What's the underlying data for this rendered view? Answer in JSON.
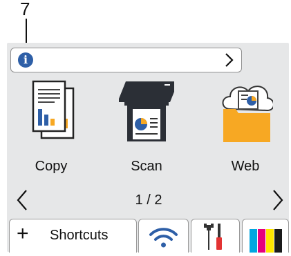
{
  "callout": {
    "number": "7"
  },
  "apps": [
    {
      "label": "Copy",
      "icon": "copy-icon"
    },
    {
      "label": "Scan",
      "icon": "scan-icon"
    },
    {
      "label": "Web",
      "icon": "web-icon"
    }
  ],
  "pagination": {
    "indicator": "1 / 2"
  },
  "tabs": {
    "shortcuts_label": "Shortcuts",
    "plus_glyph": "+",
    "wifi_icon": "wifi-icon",
    "tools_icon": "tools-icon",
    "toner_icon": "toner-icon"
  },
  "info": {
    "glyph": "i",
    "icon": "info-icon"
  },
  "colors": {
    "screen_bg": "#e6e7e8",
    "info_blue": "#2e5fa7",
    "accent_orange": "#f7a823",
    "toner_cyan": "#00a6e0",
    "toner_magenta": "#e6007e",
    "toner_yellow": "#ffe600",
    "toner_black": "#1a1a1a"
  }
}
